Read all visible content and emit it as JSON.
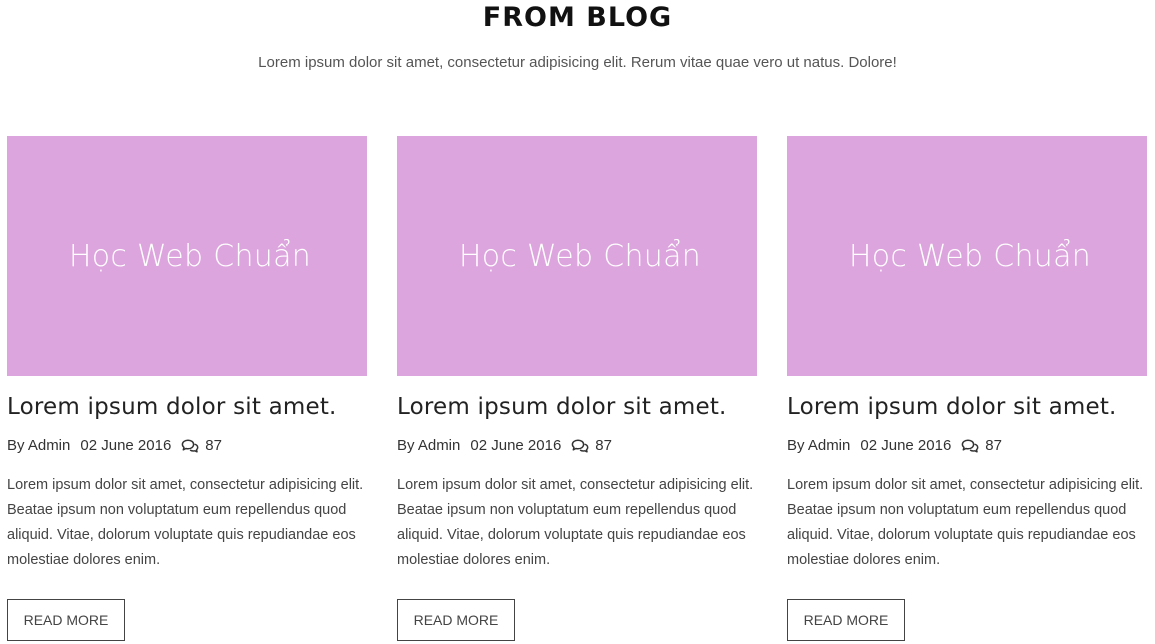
{
  "section": {
    "title": "FROM BLOG",
    "subtitle": "Lorem ipsum dolor sit amet, consectetur adipisicing elit. Rerum vitae quae vero ut natus. Dolore!"
  },
  "colors": {
    "thumbnail_bg": "#dda5dd"
  },
  "posts": [
    {
      "thumbnail_text": "Học Web Chuẩn",
      "title": "Lorem ipsum dolor sit amet.",
      "author": "By Admin",
      "date": "02 June 2016",
      "comment_icon": "comments-icon",
      "comments": "87",
      "excerpt": "Lorem ipsum dolor sit amet, consectetur adipisicing elit. Beatae ipsum non voluptatum eum repellendus quod aliquid. Vitae, dolorum voluptate quis repudiandae eos molestiae dolores enim.",
      "button_label": "READ MORE"
    },
    {
      "thumbnail_text": "Học Web Chuẩn",
      "title": "Lorem ipsum dolor sit amet.",
      "author": "By Admin",
      "date": "02 June 2016",
      "comment_icon": "comments-icon",
      "comments": "87",
      "excerpt": "Lorem ipsum dolor sit amet, consectetur adipisicing elit. Beatae ipsum non voluptatum eum repellendus quod aliquid. Vitae, dolorum voluptate quis repudiandae eos molestiae dolores enim.",
      "button_label": "READ MORE"
    },
    {
      "thumbnail_text": "Học Web Chuẩn",
      "title": "Lorem ipsum dolor sit amet.",
      "author": "By Admin",
      "date": "02 June 2016",
      "comment_icon": "comments-icon",
      "comments": "87",
      "excerpt": "Lorem ipsum dolor sit amet, consectetur adipisicing elit. Beatae ipsum non voluptatum eum repellendus quod aliquid. Vitae, dolorum voluptate quis repudiandae eos molestiae dolores enim.",
      "button_label": "READ MORE"
    }
  ]
}
